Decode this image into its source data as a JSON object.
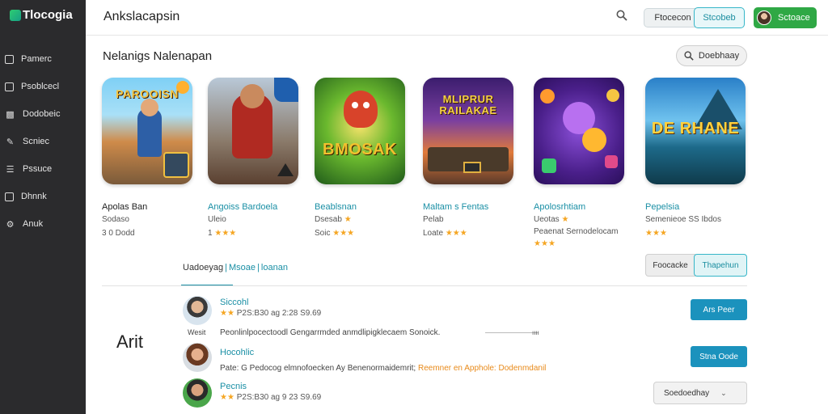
{
  "brand": {
    "name": "Tlocogia",
    "color": "#2fa845"
  },
  "header": {
    "title": "Ankslacapsin",
    "btn1": "Ftocecon",
    "btn2": "Stcobeb",
    "profile": "Sctoace",
    "search_icon": "search-icon"
  },
  "sidebar": {
    "items": [
      {
        "label": "Pamerc",
        "icon": "image-icon"
      },
      {
        "label": "Psoblcecl",
        "icon": "square-icon"
      },
      {
        "label": "Dodobeic",
        "icon": "gamepad-icon"
      },
      {
        "label": "Scniec",
        "icon": "pen-icon"
      },
      {
        "label": "Pssuce",
        "icon": "list-icon"
      },
      {
        "label": "Dhnnk",
        "icon": "calendar-icon"
      },
      {
        "label": "Anuk",
        "icon": "gear-icon"
      }
    ]
  },
  "section": {
    "title": "Nelanigs Nalenapan",
    "display_btn": "Doebhaay"
  },
  "apps": [
    {
      "art_text": "PAROOISN",
      "title": "Apolas Ban",
      "meta": "Sodaso",
      "stars": "3 0 Dodd",
      "highlight": false
    },
    {
      "art_text": "",
      "title": "Angoiss Bardoela",
      "meta": "Uleio",
      "stars": "1 ★★★",
      "highlight": true
    },
    {
      "art_text": "BMOSAK",
      "title": "Beablsnan",
      "meta": "Dsesab ★",
      "stars": "Soic ★★★",
      "highlight": true
    },
    {
      "art_text": "MLIPRUR RAILAKAE",
      "title": "Maltam s Fentas",
      "meta": "Pelab",
      "stars": "Loate ★★★",
      "highlight": true
    },
    {
      "art_text": "",
      "title": "Apolosrhtiam",
      "meta": "Ueotas ★",
      "stars": "★★★",
      "meta2": "Peaenat Sernodelocam",
      "highlight": true
    },
    {
      "art_text": "DE RHANE",
      "title": "Pepelsia",
      "meta": "Semenieoe SS Ibdos",
      "stars": "★★★",
      "highlight": true
    }
  ],
  "tabs": {
    "label1": "Uadoeyag",
    "sep": "|",
    "label2": "Msoae",
    "sep2": "|",
    "label3": "loanan"
  },
  "segments": {
    "seg1": "Foocacke",
    "seg2": "Thapehun"
  },
  "left_label": "Arit",
  "reviews": [
    {
      "name": "Siccohl",
      "stars": "★★ P2S:B30  ag  2:28 S9.69",
      "btn": "Ars Peer"
    },
    {
      "name": "Hocohlic",
      "text": "Pate: G Pedocog elmnofoecken  Ay  Benenormaidemrit;",
      "text_orange": "Reemner en Apphole: Dodenmdanil",
      "btn": "Stna Oode"
    },
    {
      "name": "Pecnis",
      "stars": "★★ P2S:B30  ag  9 23 S9.69",
      "select": "Soedoedhay"
    }
  ],
  "reply": {
    "label": "Wesit",
    "text": "Peonlinlpocectoodl Gengarrmded anmdlipigklecaem Sonoick.",
    "dot": "ıııı"
  }
}
